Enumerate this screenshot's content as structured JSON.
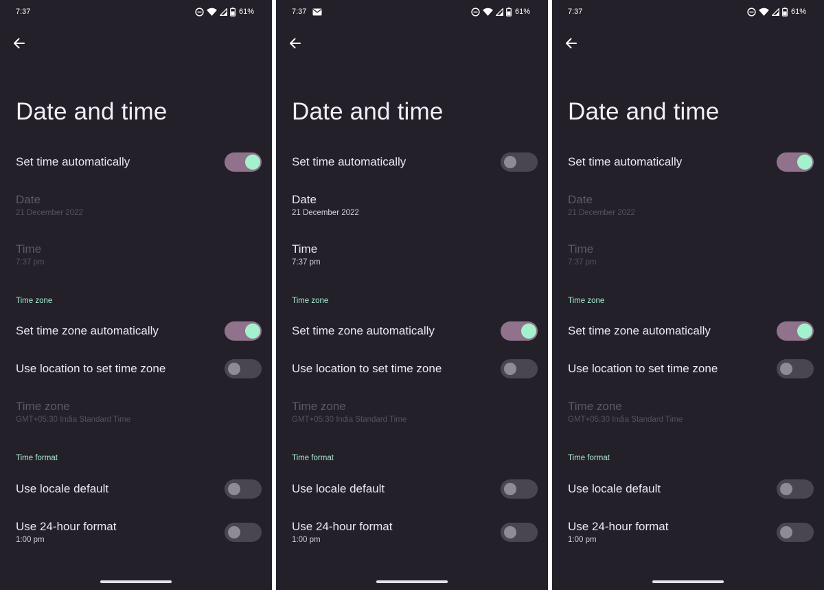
{
  "screens": [
    {
      "status": {
        "time": "7:37",
        "battery": "61%",
        "show_mail": false
      },
      "title": "Date and time",
      "set_time_auto": {
        "label": "Set time automatically",
        "on": true
      },
      "date": {
        "label": "Date",
        "value": "21 December 2022",
        "enabled": false
      },
      "time": {
        "label": "Time",
        "value": "7:37 pm",
        "enabled": false
      },
      "time_zone_header": "Time zone",
      "set_tz_auto": {
        "label": "Set time zone automatically",
        "on": true
      },
      "use_location": {
        "label": "Use location to set time zone",
        "on": false
      },
      "time_zone": {
        "label": "Time zone",
        "value": "GMT+05:30 India Standard Time",
        "enabled": false
      },
      "time_format_header": "Time format",
      "locale_default": {
        "label": "Use locale default",
        "on": false
      },
      "use_24h": {
        "label": "Use 24-hour format",
        "value": "1:00 pm",
        "on": false
      }
    },
    {
      "status": {
        "time": "7:37",
        "battery": "61%",
        "show_mail": true
      },
      "title": "Date and time",
      "set_time_auto": {
        "label": "Set time automatically",
        "on": false
      },
      "date": {
        "label": "Date",
        "value": "21 December 2022",
        "enabled": true
      },
      "time": {
        "label": "Time",
        "value": "7:37 pm",
        "enabled": true
      },
      "time_zone_header": "Time zone",
      "set_tz_auto": {
        "label": "Set time zone automatically",
        "on": true
      },
      "use_location": {
        "label": "Use location to set time zone",
        "on": false
      },
      "time_zone": {
        "label": "Time zone",
        "value": "GMT+05:30 India Standard Time",
        "enabled": false
      },
      "time_format_header": "Time format",
      "locale_default": {
        "label": "Use locale default",
        "on": false
      },
      "use_24h": {
        "label": "Use 24-hour format",
        "value": "1:00 pm",
        "on": false
      }
    },
    {
      "status": {
        "time": "7:37",
        "battery": "61%",
        "show_mail": false
      },
      "title": "Date and time",
      "set_time_auto": {
        "label": "Set time automatically",
        "on": true
      },
      "date": {
        "label": "Date",
        "value": "21 December 2022",
        "enabled": false
      },
      "time": {
        "label": "Time",
        "value": "7:37 pm",
        "enabled": false
      },
      "time_zone_header": "Time zone",
      "set_tz_auto": {
        "label": "Set time zone automatically",
        "on": true
      },
      "use_location": {
        "label": "Use location to set time zone",
        "on": false
      },
      "time_zone": {
        "label": "Time zone",
        "value": "GMT+05:30 India Standard Time",
        "enabled": false
      },
      "time_format_header": "Time format",
      "locale_default": {
        "label": "Use locale default",
        "on": false
      },
      "use_24h": {
        "label": "Use 24-hour format",
        "value": "1:00 pm",
        "on": false
      }
    }
  ],
  "colors": {
    "background": "#24202a",
    "accent_header": "#a6ecd0",
    "switch_on_track": "#91728c",
    "switch_on_thumb": "#a4f2cd",
    "switch_off_track": "#4a4650",
    "switch_off_thumb": "#8e8a96",
    "divider": "#ffffff"
  },
  "icons": {
    "back": "back-arrow-icon",
    "mail": "mail-icon",
    "dnd": "do-not-disturb-icon",
    "wifi": "wifi-icon",
    "signal": "cell-signal-icon",
    "battery": "battery-icon"
  }
}
